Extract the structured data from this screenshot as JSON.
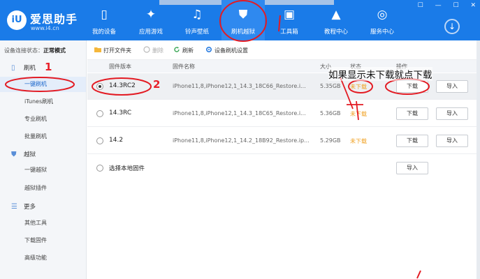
{
  "app": {
    "name": "爱思助手",
    "url": "www.i4.cn",
    "logo_mark": "iU",
    "nav": [
      {
        "label": "我的设备",
        "icon": "phone-icon"
      },
      {
        "label": "应用游戏",
        "icon": "app-store-icon"
      },
      {
        "label": "铃声壁纸",
        "icon": "music-icon"
      },
      {
        "label": "刷机越狱",
        "icon": "shield-icon"
      },
      {
        "label": "工具箱",
        "icon": "toolbox-icon"
      },
      {
        "label": "教程中心",
        "icon": "graduation-cap-icon"
      },
      {
        "label": "服务中心",
        "icon": "compass-icon"
      }
    ],
    "window_controls": [
      "☐",
      "—",
      "☐",
      "✕"
    ]
  },
  "sidebar": {
    "status_label": "设备连接状态：",
    "status_value": "正常模式",
    "sections": {
      "flash": "刷机",
      "jailbreak": "越狱",
      "more": "更多"
    },
    "items": {
      "one_click_flash": "一键刷机",
      "itunes_flash": "iTunes刷机",
      "pro_flash": "专业刷机",
      "batch_flash": "批量刷机",
      "one_click_jailbreak": "一键越狱",
      "jailbreak_plugins": "越狱插件",
      "other_tools": "其他工具",
      "download_firmware": "下载固件",
      "advanced": "高级功能"
    }
  },
  "toolbar": {
    "open_folder": "打开文件夹",
    "delete": "删除",
    "refresh": "刷新",
    "device_settings": "设备刷机设置"
  },
  "table": {
    "headers": {
      "version": "固件版本",
      "name": "固件名称",
      "size": "大小",
      "status": "状态",
      "action": "操作"
    },
    "rows": [
      {
        "version": "14.3RC2",
        "file": "iPhone11,8,iPhone12,1_14.3_18C66_Restore.i...",
        "size": "5.35GB",
        "status": "未下载",
        "download": "下载",
        "import": "导入",
        "selected": true
      },
      {
        "version": "14.3RC",
        "file": "iPhone11,8,iPhone12,1_14.3_18C65_Restore.i...",
        "size": "5.36GB",
        "status": "未下载",
        "download": "下载",
        "import": "导入",
        "selected": false
      },
      {
        "version": "14.2",
        "file": "iPhone11,8,iPhone12,1_14.2_18B92_Restore.ip...",
        "size": "5.29GB",
        "status": "未下载",
        "download": "下载",
        "import": "导入",
        "selected": false
      }
    ],
    "local": {
      "label": "选择本地固件",
      "import": "导入"
    }
  },
  "annotations": {
    "note": "如果显示未下载就点下载",
    "mark_1": "1",
    "mark_2": "2"
  }
}
